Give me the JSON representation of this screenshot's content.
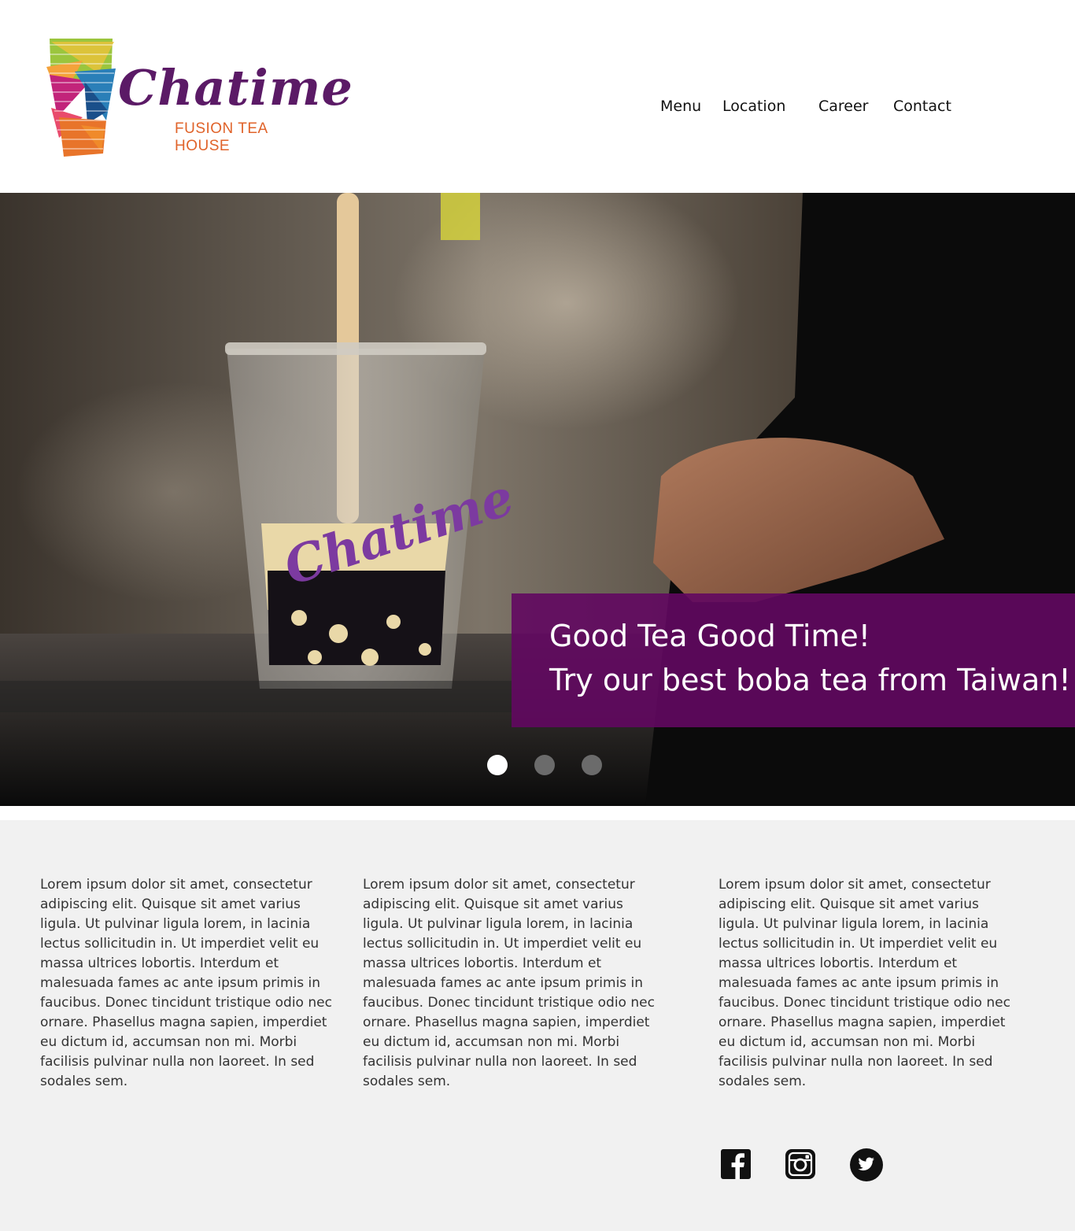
{
  "brand": {
    "name": "Chatime",
    "tagline": "FUSION TEA HOUSE",
    "colors": {
      "purple": "#5b1a66",
      "orange": "#e0632a",
      "caption_bg": "#620860"
    }
  },
  "nav": {
    "items": [
      {
        "label": "Menu"
      },
      {
        "label": "Location"
      },
      {
        "label": "Career"
      },
      {
        "label": "Contact"
      }
    ]
  },
  "hero": {
    "caption_line1": "Good Tea Good Time!",
    "caption_line2": "Try our best boba tea from Taiwan!",
    "slides": {
      "count": 3,
      "active": 1
    }
  },
  "columns": [
    {
      "text": "Lorem ipsum dolor sit amet, consectetur adipiscing elit. Quisque sit amet varius ligula. Ut pulvinar ligula lorem, in lacinia lectus sollicitudin in. Ut imperdiet velit eu massa ultrices lobortis. Interdum et malesuada fames ac ante ipsum primis in faucibus. Donec tincidunt tristique odio nec ornare. Phasellus magna sapien, imperdiet eu dictum id, accumsan non mi. Morbi facilisis pulvinar nulla non laoreet. In sed sodales sem."
    },
    {
      "text": "Lorem ipsum dolor sit amet, consectetur adipiscing elit. Quisque sit amet varius ligula. Ut pulvinar ligula lorem, in lacinia lectus sollicitudin in. Ut imperdiet velit eu massa ultrices lobortis. Interdum et malesuada fames ac ante ipsum primis in faucibus. Donec tincidunt tristique odio nec ornare. Phasellus magna sapien, imperdiet eu dictum id, accumsan non mi. Morbi facilisis pulvinar nulla non laoreet. In sed sodales sem."
    },
    {
      "text": "Lorem ipsum dolor sit amet, consectetur adipiscing elit. Quisque sit amet varius ligula. Ut pulvinar ligula lorem, in lacinia lectus sollicitudin in. Ut imperdiet velit eu massa ultrices lobortis. Interdum et malesuada fames ac ante ipsum primis in faucibus. Donec tincidunt tristique odio nec ornare. Phasellus magna sapien, imperdiet eu dictum id, accumsan non mi. Morbi facilisis pulvinar nulla non laoreet. In sed sodales sem."
    }
  ],
  "social": [
    {
      "icon": "facebook-icon"
    },
    {
      "icon": "instagram-icon"
    },
    {
      "icon": "twitter-icon"
    }
  ]
}
